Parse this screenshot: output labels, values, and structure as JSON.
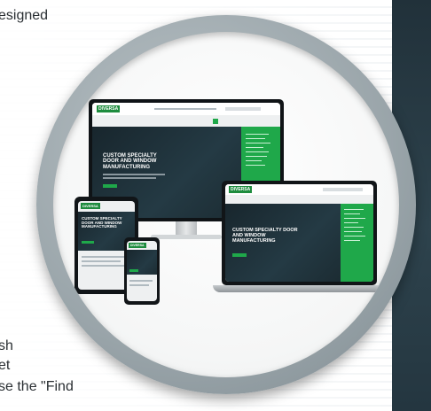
{
  "background_text": {
    "line1": "esigned",
    "line2": "sh",
    "line3": "et",
    "line4": "se the \"Find"
  },
  "screens": {
    "logo_text": "DIVERSA",
    "hero_heading": "CUSTOM SPECIALTY DOOR AND WINDOW MANUFACTURING",
    "hero_heading_short": "CUSTOM SPECIALTY DOOR AND WINDOW MANUFACTURING"
  },
  "colors": {
    "accent_green": "#1fa84a",
    "dark_panel": "#2e434d"
  }
}
